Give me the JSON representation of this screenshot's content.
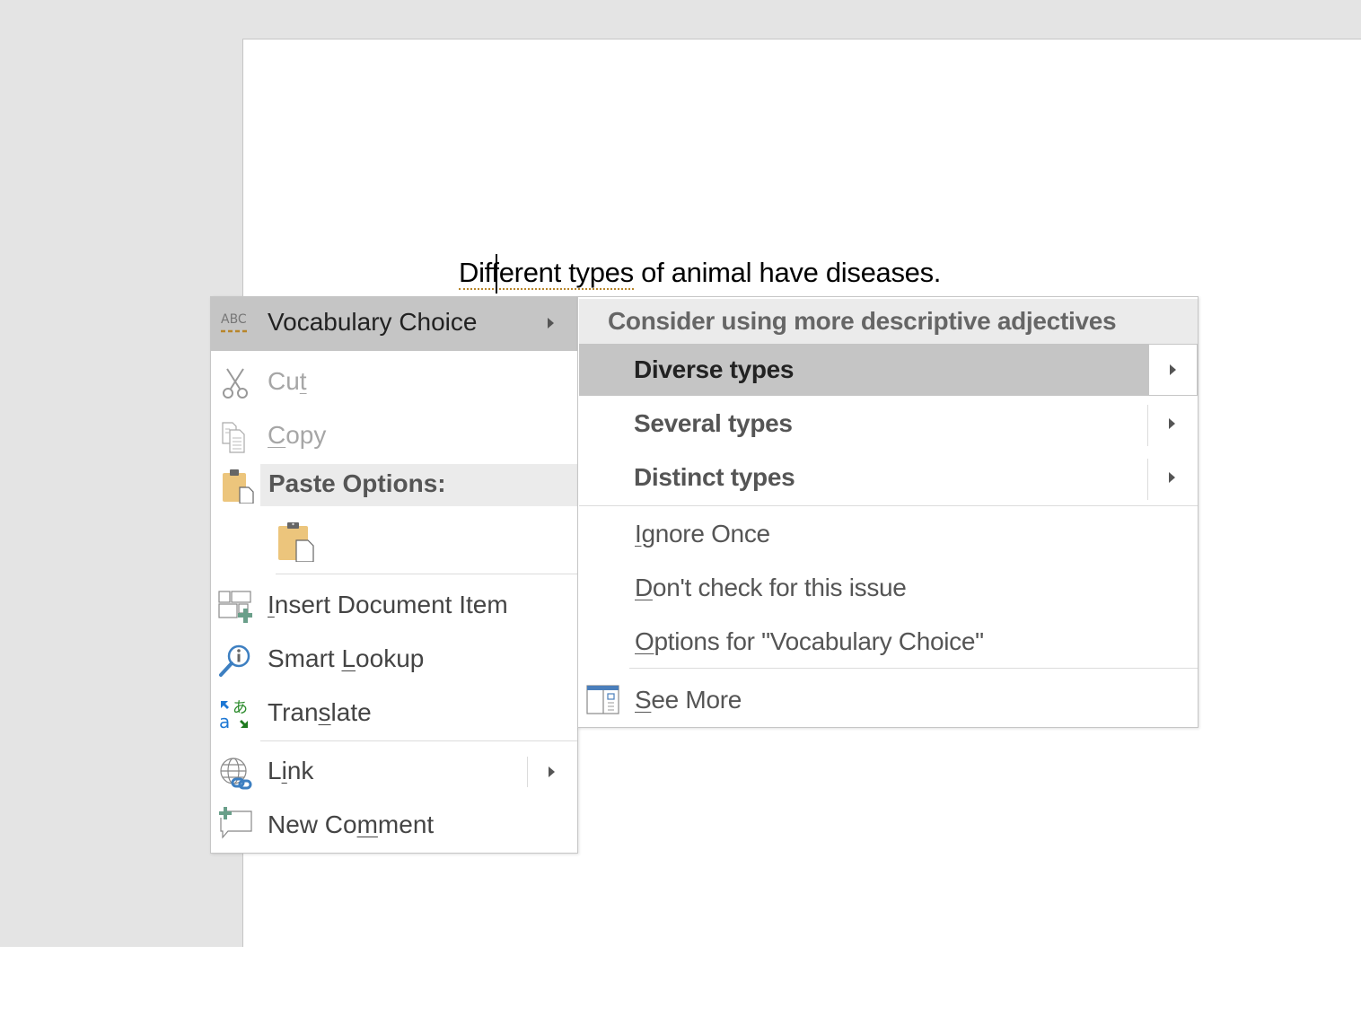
{
  "document": {
    "sentence_flagged": "Different types",
    "sentence_rest": " of animal have diseases."
  },
  "context_menu": {
    "vocabulary": {
      "label": "Vocabulary Choice",
      "icon": "abc-proofing-icon"
    },
    "cut": {
      "pre": "Cu",
      "accel": "t",
      "post": "",
      "icon": "scissors-icon",
      "disabled": true
    },
    "copy": {
      "pre": "",
      "accel": "C",
      "post": "opy",
      "icon": "copy-icon",
      "disabled": true
    },
    "paste_options": {
      "label": "Paste Options:",
      "icon": "clipboard-icon"
    },
    "insert_document_item": {
      "pre": "",
      "accel": "I",
      "post": "nsert Document Item",
      "icon": "insert-document-item-icon"
    },
    "smart_lookup": {
      "pre": "Smart ",
      "accel": "L",
      "post": "ookup",
      "icon": "smart-lookup-icon"
    },
    "translate": {
      "pre": "Tran",
      "accel": "s",
      "post": "late",
      "icon": "translate-icon"
    },
    "link": {
      "pre": "L",
      "accel": "i",
      "post": "nk",
      "icon": "link-globe-icon"
    },
    "new_comment": {
      "pre": "New Co",
      "accel": "m",
      "post": "ment",
      "icon": "new-comment-icon"
    }
  },
  "submenu": {
    "header": "Consider using more descriptive adjectives",
    "suggestions": [
      {
        "label": "Diverse types",
        "active": true
      },
      {
        "label": "Several types",
        "active": false
      },
      {
        "label": "Distinct types",
        "active": false
      }
    ],
    "ignore_once": {
      "pre": "",
      "accel": "I",
      "post": "gnore Once"
    },
    "dont_check": {
      "pre": "",
      "accel": "D",
      "post": "on't check for this issue"
    },
    "options": {
      "pre": "",
      "accel": "O",
      "post": "ptions for \"Vocabulary Choice\""
    },
    "see_more": {
      "pre": "",
      "accel": "S",
      "post": "ee More",
      "icon": "see-more-pane-icon"
    }
  },
  "colors": {
    "workspace_bg": "#e4e4e4",
    "highlight": "#c5c5c5",
    "header_bg": "#ebebeb",
    "proofing_underline": "#b8862b"
  }
}
